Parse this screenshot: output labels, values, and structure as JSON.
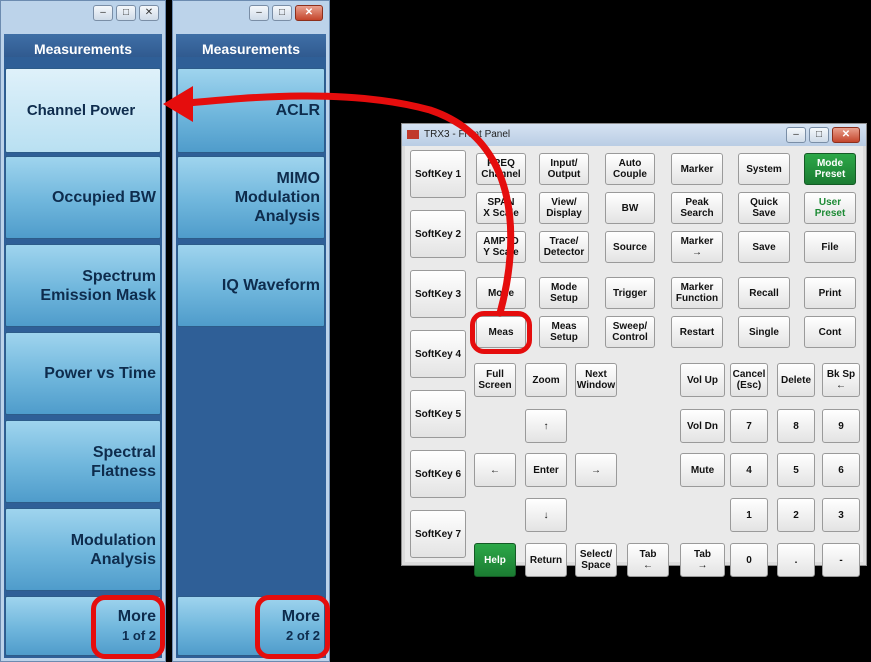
{
  "left_panel": {
    "header": "Measurements",
    "buttons": [
      {
        "line1": "Channel Power"
      },
      {
        "line1": "Occupied BW"
      },
      {
        "line1": "Spectrum",
        "line2": "Emission Mask"
      },
      {
        "line1": "Power vs Time"
      },
      {
        "line1": "Spectral",
        "line2": "Flatness"
      },
      {
        "line1": "Modulation",
        "line2": "Analysis"
      },
      {
        "line1": "More",
        "line2": "1 of 2"
      }
    ]
  },
  "right_panel": {
    "header": "Measurements",
    "buttons": [
      {
        "line1": "ACLR"
      },
      {
        "line1": "MIMO",
        "line2": "Modulation",
        "line3": "Analysis"
      },
      {
        "line1": "IQ Waveform"
      },
      {
        "line1": "More",
        "line2": "2 of 2"
      }
    ]
  },
  "front_panel": {
    "title": "TRX3 - Front Panel",
    "softkeys": [
      "SoftKey 1",
      "SoftKey 2",
      "SoftKey 3",
      "SoftKey 4",
      "SoftKey 5",
      "SoftKey 6",
      "SoftKey 7"
    ],
    "keys": {
      "freq": "FREQ\nChannel",
      "input_output": "Input/\nOutput",
      "auto_couple": "Auto\nCouple",
      "marker": "Marker",
      "system": "System",
      "mode_preset": "Mode\nPreset",
      "span": "SPAN\nX Scale",
      "view_display": "View/\nDisplay",
      "bw": "BW",
      "peak_search": "Peak\nSearch",
      "quick_save": "Quick\nSave",
      "user_preset": "User\nPreset",
      "amptd": "AMPTD\nY Scale",
      "trace_detector": "Trace/\nDetector",
      "source": "Source",
      "marker_arrow": "Marker\n→",
      "save": "Save",
      "file": "File",
      "mode": "Mode",
      "mode_setup": "Mode\nSetup",
      "trigger": "Trigger",
      "marker_function": "Marker\nFunction",
      "recall": "Recall",
      "print": "Print",
      "meas": "Meas",
      "meas_setup": "Meas\nSetup",
      "sweep_control": "Sweep/\nControl",
      "restart": "Restart",
      "single": "Single",
      "cont": "Cont",
      "full_screen": "Full\nScreen",
      "zoom": "Zoom",
      "next_window": "Next\nWindow",
      "vol_up": "Vol Up",
      "cancel_esc": "Cancel\n(Esc)",
      "delete": "Delete",
      "bk_sp": "Bk Sp\n←",
      "up": "↑",
      "vol_dn": "Vol Dn",
      "n7": "7",
      "n8": "8",
      "n9": "9",
      "left": "←",
      "enter": "Enter",
      "right": "→",
      "mute": "Mute",
      "n4": "4",
      "n5": "5",
      "n6": "6",
      "down": "↓",
      "n1": "1",
      "n2": "2",
      "n3": "3",
      "help": "Help",
      "return": "Return",
      "select_space": "Select/\nSpace",
      "tab_left": "Tab\n←",
      "tab_right": "Tab\n→",
      "n0": "0",
      "dot": ".",
      "minus": "-"
    }
  },
  "colors": {
    "annotation": "#e50d0d",
    "help_key": "#1b7c32",
    "preset_text": "#1c8a34"
  }
}
